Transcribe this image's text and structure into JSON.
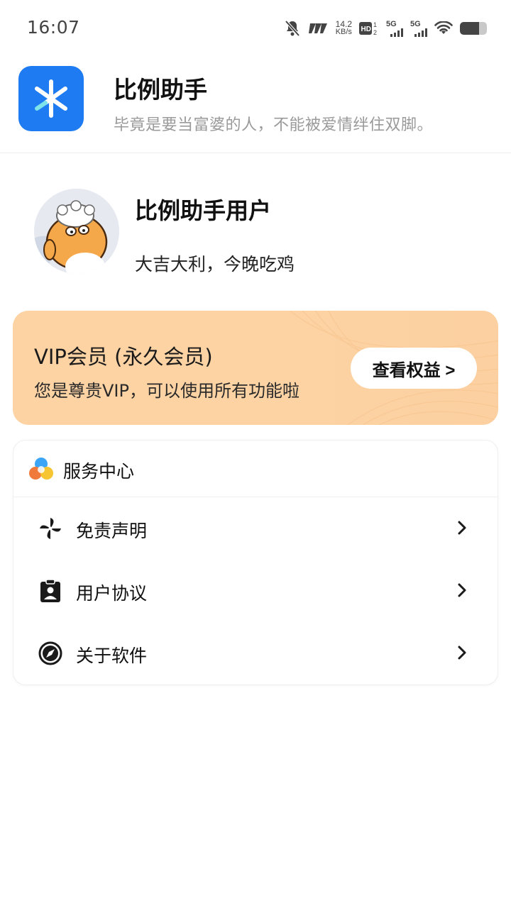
{
  "status_bar": {
    "time": "16:07",
    "net_speed_value": "14.2",
    "net_speed_unit": "KB/s",
    "sim1_label": "5G",
    "sim2_label": "5G",
    "battery_level": 0.7,
    "icons": [
      "mute-bell-icon",
      "nfc-icon",
      "hd-icon",
      "signal-icon",
      "wifi-icon",
      "battery-icon"
    ]
  },
  "app": {
    "name": "比例助手",
    "slogan": "毕竟是要当富婆的人，不能被爱情绊住双脚。",
    "logo_color": "#1e7bf2"
  },
  "profile": {
    "name": "比例助手用户",
    "motto": "大吉大利，今晚吃鸡"
  },
  "vip": {
    "title": "VIP会员 (永久会员)",
    "description": "您是尊贵VIP，可以使用所有功能啦",
    "button_label": "查看权益 >",
    "card_color": "#fdd3a4"
  },
  "service_center": {
    "title": "服务中心",
    "items": [
      {
        "label": "免责声明",
        "icon": "pinwheel-icon"
      },
      {
        "label": "用户协议",
        "icon": "clipboard-user-icon"
      },
      {
        "label": "关于软件",
        "icon": "compass-icon"
      }
    ]
  }
}
